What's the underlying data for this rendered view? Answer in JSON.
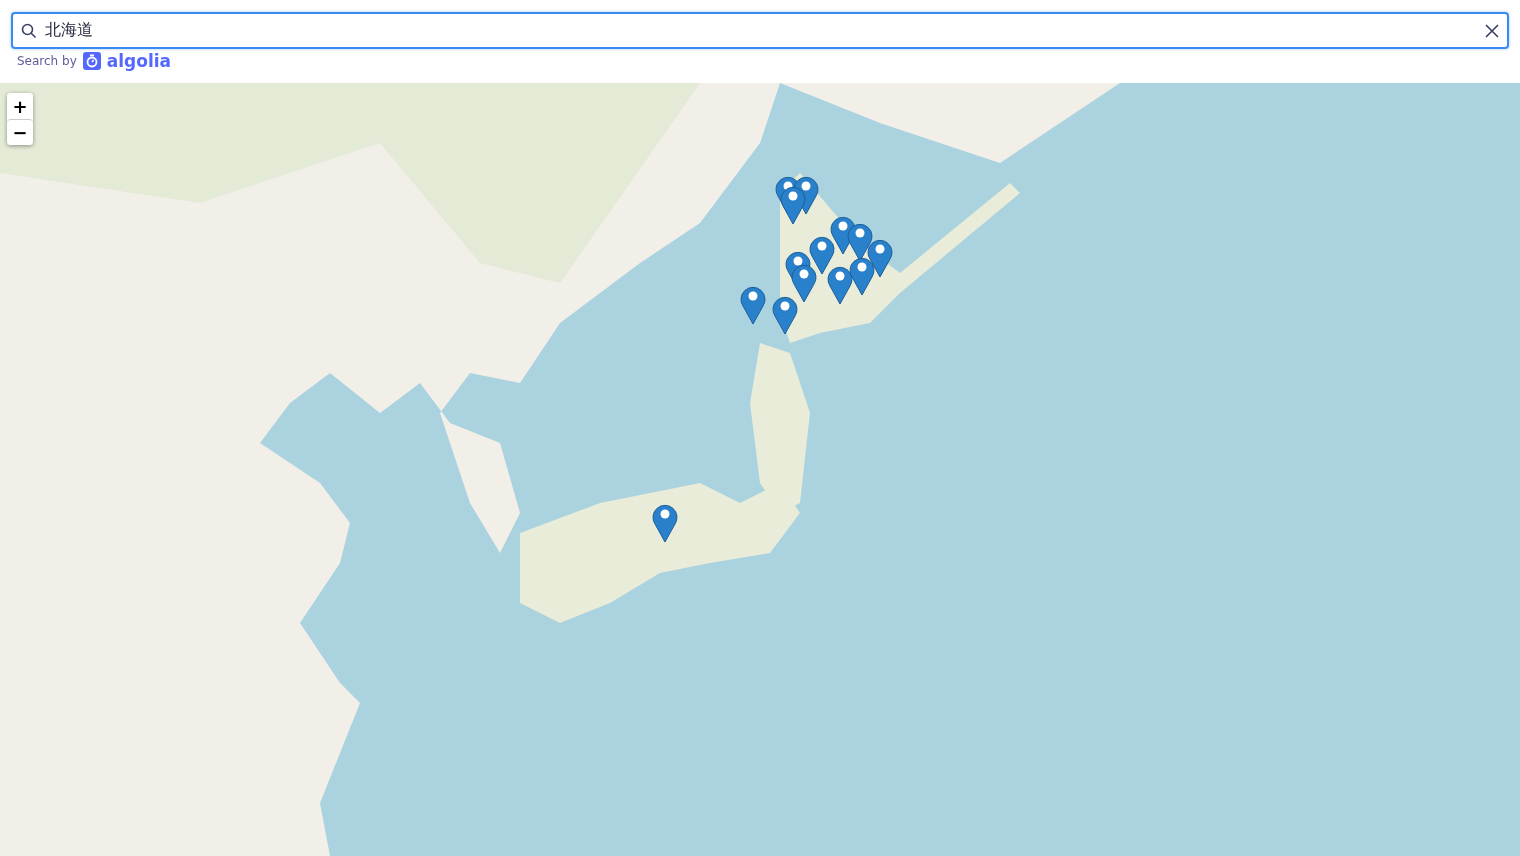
{
  "search": {
    "value": "北海道",
    "attribution_prefix": "Search by",
    "attribution_brand": "algolia"
  },
  "map": {
    "zoom_in": "+",
    "zoom_out": "−"
  }
}
